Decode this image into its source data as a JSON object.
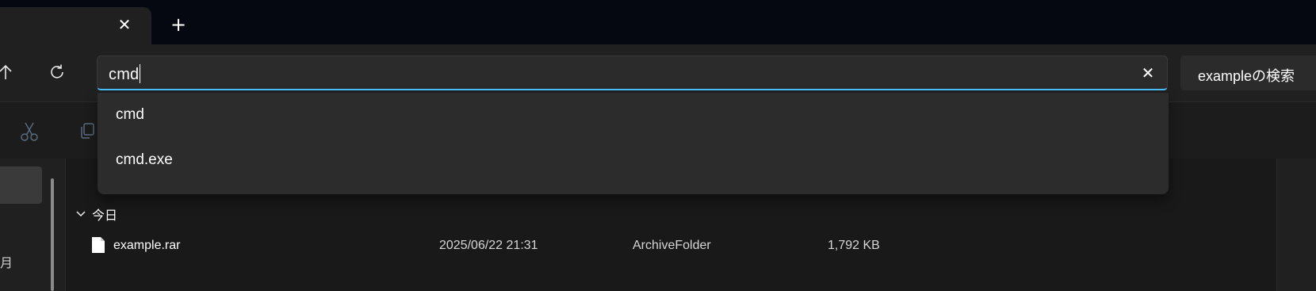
{
  "tab": {
    "close_glyph": "✕",
    "new_glyph": "+"
  },
  "nav": {
    "up_icon": "arrow-up-icon",
    "refresh_icon": "refresh-icon"
  },
  "address": {
    "value": "cmd",
    "clear_glyph": "✕",
    "accent": "#4cc2ff"
  },
  "search": {
    "label": "exampleの検索"
  },
  "suggestions": [
    {
      "label": "cmd"
    },
    {
      "label": "cmd.exe"
    }
  ],
  "sidebar": {
    "partial_text": "月"
  },
  "content": {
    "group_label": "今日",
    "files": [
      {
        "name": "example.rar",
        "modified": "2025/06/22 21:31",
        "type": "ArchiveFolder",
        "size": "1,792 KB"
      }
    ]
  }
}
